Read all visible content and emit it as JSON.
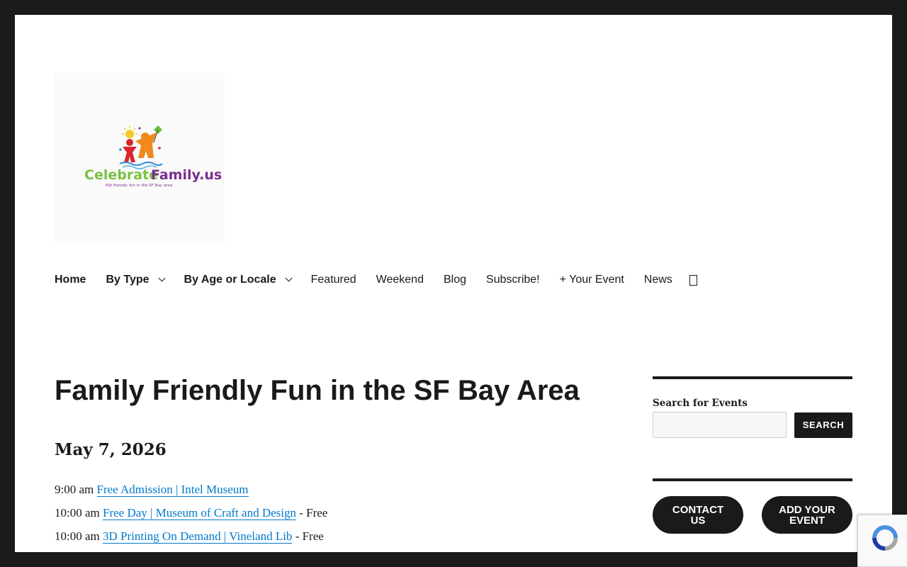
{
  "site": {
    "logo_text": "CelebrateFamily.us",
    "logo_tagline": "Kid friendly fun in the SF Bay area"
  },
  "nav": {
    "items": [
      {
        "label": "Home"
      },
      {
        "label": "By Type"
      },
      {
        "label": "By Age or Locale"
      },
      {
        "label": "Featured"
      },
      {
        "label": "Weekend"
      },
      {
        "label": "Blog"
      },
      {
        "label": "Subscribe!"
      },
      {
        "label": "+ Your Event"
      },
      {
        "label": "News"
      }
    ],
    "search_icon": "search-toggle-icon"
  },
  "main": {
    "title": "Family Friendly Fun in the SF Bay Area",
    "date": "May 7, 2026",
    "events": [
      {
        "time": "9:00 am",
        "title": "Free Admission | Intel Museum",
        "suffix": ""
      },
      {
        "time": "10:00 am",
        "title": "Free Day | Museum of Craft and Design",
        "suffix": " - Free"
      },
      {
        "time": "10:00 am",
        "title": "3D Printing On Demand | Vineland Lib",
        "suffix": " - Free"
      }
    ]
  },
  "sidebar": {
    "search_label": "Search for Events",
    "search_placeholder": "",
    "search_button": "SEARCH",
    "contact_button": "CONTACT US",
    "add_event_button": "ADD YOUR EVENT"
  },
  "colors": {
    "frame": "#1a1a1a",
    "link": "#007acc",
    "text": "#1a1a1a"
  }
}
